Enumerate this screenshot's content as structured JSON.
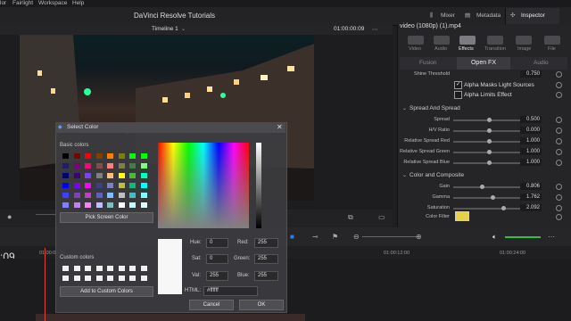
{
  "menu": [
    "lor",
    "Fairlight",
    "Workspace",
    "Help"
  ],
  "app_title": "DaVinci Resolve Tutorials",
  "header_buttons": {
    "mixer": "Mixer",
    "metadata": "Metadata",
    "inspector": "Inspector"
  },
  "viewer": {
    "timeline_name": "Timeline 1",
    "timecode": "01:00:00:09"
  },
  "inspector": {
    "clip_title": "video (1080p) (1).mp4",
    "tabs": [
      "Video",
      "Audio",
      "Effects",
      "Transition",
      "Image",
      "File"
    ],
    "subtabs": [
      "Fusion",
      "Open FX",
      "Audio"
    ],
    "shine_threshold": {
      "label": "Shine Threshold",
      "value": "0.750"
    },
    "checks": [
      {
        "label": "Alpha Masks Light Sources",
        "checked": true
      },
      {
        "label": "Alpha Limits Effect",
        "checked": false
      }
    ],
    "sections": {
      "spread": "Spread And Spread",
      "color": "Color and Composite"
    },
    "spread_props": [
      {
        "label": "Spread",
        "value": "0.500",
        "pos": 0.5
      },
      {
        "label": "H/V Ratio",
        "value": "0.000",
        "pos": 0.5
      },
      {
        "label": "Relative Spread Red",
        "value": "1.000",
        "pos": 0.5
      },
      {
        "label": "Relative Spread Green",
        "value": "1.000",
        "pos": 0.5
      },
      {
        "label": "Relative Spread Blue",
        "value": "1.000",
        "pos": 0.5
      }
    ],
    "color_props": [
      {
        "label": "Gain",
        "value": "0.806",
        "pos": 0.4
      },
      {
        "label": "Gamma",
        "value": "1.762",
        "pos": 0.55
      },
      {
        "label": "Saturation",
        "value": "2.092",
        "pos": 0.7
      }
    ],
    "color_filter_label": "Color Filter",
    "color_filter_color": "#e6d24a"
  },
  "timeline": {
    "timecode": ":09",
    "ruler": [
      "01:00:00:00",
      "01:00:12:00",
      "01:00:24:00"
    ]
  },
  "dialog": {
    "title": "Select Color",
    "basic_colors_label": "Basic colors",
    "pick_screen_label": "Pick Screen Color",
    "custom_colors_label": "Custom colors",
    "add_custom_label": "Add to Custom Colors",
    "fields": {
      "hue": {
        "label": "Hue:",
        "value": "0"
      },
      "sat": {
        "label": "Sat:",
        "value": "0"
      },
      "val": {
        "label": "Val:",
        "value": "255"
      },
      "red": {
        "label": "Red:",
        "value": "255"
      },
      "green": {
        "label": "Green:",
        "value": "255"
      },
      "blue": {
        "label": "Blue:",
        "value": "255"
      },
      "html": {
        "label": "HTML:",
        "value": "#ffffff"
      }
    },
    "cancel": "Cancel",
    "ok": "OK",
    "basic_swatches": [
      "#000000",
      "#7f0000",
      "#ff0000",
      "#7f3f00",
      "#ff7f00",
      "#7f7f00",
      "#00ff00",
      "#00ff00",
      "#202060",
      "#7f007f",
      "#ff007f",
      "#7f4f4f",
      "#ff7f7f",
      "#7f7f3f",
      "#3f7f3f",
      "#7fff7f",
      "#00007f",
      "#3f007f",
      "#7f3fff",
      "#7f7f7f",
      "#ffbf7f",
      "#ffff00",
      "#3fbf3f",
      "#00ffbf",
      "#0000ff",
      "#7f00ff",
      "#ff00ff",
      "#3f3f7f",
      "#7f7fbf",
      "#bfbf3f",
      "#00bf7f",
      "#00ffff",
      "#3f3fff",
      "#7f3fbf",
      "#bf3fbf",
      "#5f5fbf",
      "#7fbfff",
      "#bfbfbf",
      "#3fbfbf",
      "#7fffff",
      "#7f7fff",
      "#bf7fff",
      "#ff7fff",
      "#bfbfff",
      "#7fbfbf",
      "#ffffff",
      "#bfffff",
      "#dfffff"
    ]
  }
}
